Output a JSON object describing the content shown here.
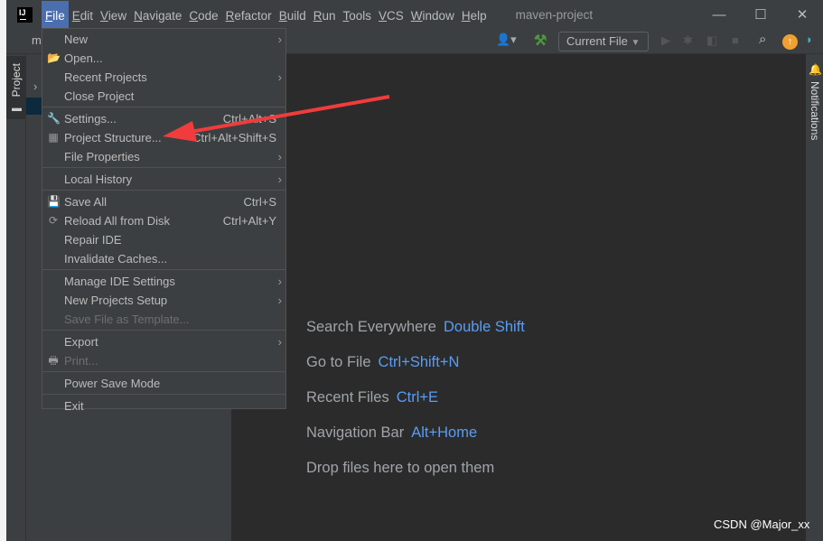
{
  "menubar": {
    "items": [
      {
        "label": "File",
        "u": "F",
        "rest": "ile"
      },
      {
        "u": "E",
        "rest": "dit"
      },
      {
        "u": "V",
        "rest": "iew"
      },
      {
        "u": "N",
        "rest": "avigate"
      },
      {
        "u": "C",
        "rest": "ode"
      },
      {
        "u": "R",
        "rest": "efactor"
      },
      {
        "u": "B",
        "rest": "uild"
      },
      {
        "u": "R",
        "rest": "un"
      },
      {
        "u": "T",
        "rest": "ools"
      },
      {
        "u": "V",
        "rest": "CS"
      },
      {
        "u": "W",
        "rest": "indow"
      },
      {
        "u": "H",
        "rest": "elp"
      }
    ]
  },
  "window": {
    "title": "maven-project",
    "project_label": "m"
  },
  "toolbar": {
    "run_config": "Current File"
  },
  "sidebar": {
    "project_tab": "Project",
    "notifications": "Notifications"
  },
  "file_menu": {
    "items": [
      {
        "label": "New",
        "submenu": true
      },
      {
        "label": "Open...",
        "icon": "folder-open-icon"
      },
      {
        "label": "Recent Projects",
        "submenu": true
      },
      {
        "label": "Close Project"
      },
      {
        "sep": true
      },
      {
        "label": "Settings...",
        "shortcut": "Ctrl+Alt+S",
        "icon": "wrench-icon"
      },
      {
        "label": "Project Structure...",
        "shortcut": "Ctrl+Alt+Shift+S",
        "icon": "project-structure-icon"
      },
      {
        "label": "File Properties",
        "submenu": true
      },
      {
        "sep": true
      },
      {
        "label": "Local History",
        "submenu": true
      },
      {
        "sep": true
      },
      {
        "label": "Save All",
        "shortcut": "Ctrl+S",
        "icon": "save-icon"
      },
      {
        "label": "Reload All from Disk",
        "shortcut": "Ctrl+Alt+Y",
        "icon": "reload-icon"
      },
      {
        "label": "Repair IDE"
      },
      {
        "label": "Invalidate Caches..."
      },
      {
        "sep": true
      },
      {
        "label": "Manage IDE Settings",
        "submenu": true
      },
      {
        "label": "New Projects Setup",
        "submenu": true
      },
      {
        "label": "Save File as Template...",
        "disabled": true
      },
      {
        "sep": true
      },
      {
        "label": "Export",
        "submenu": true
      },
      {
        "label": "Print...",
        "disabled": true,
        "icon": "print-icon"
      },
      {
        "sep": true
      },
      {
        "label": "Power Save Mode"
      },
      {
        "sep": true
      },
      {
        "label": "Exit"
      }
    ]
  },
  "editor_hints": [
    {
      "label": "Search Everywhere",
      "key": "Double Shift"
    },
    {
      "label": "Go to File",
      "key": "Ctrl+Shift+N"
    },
    {
      "label": "Recent Files",
      "key": "Ctrl+E"
    },
    {
      "label": "Navigation Bar",
      "key": "Alt+Home"
    },
    {
      "label": "Drop files here to open them",
      "key": ""
    }
  ],
  "watermark": "CSDN @Major_xx",
  "colors": {
    "accent": "#4b6eaf",
    "shortcut": "#589df6",
    "annotation_arrow": "#f03c3c"
  }
}
